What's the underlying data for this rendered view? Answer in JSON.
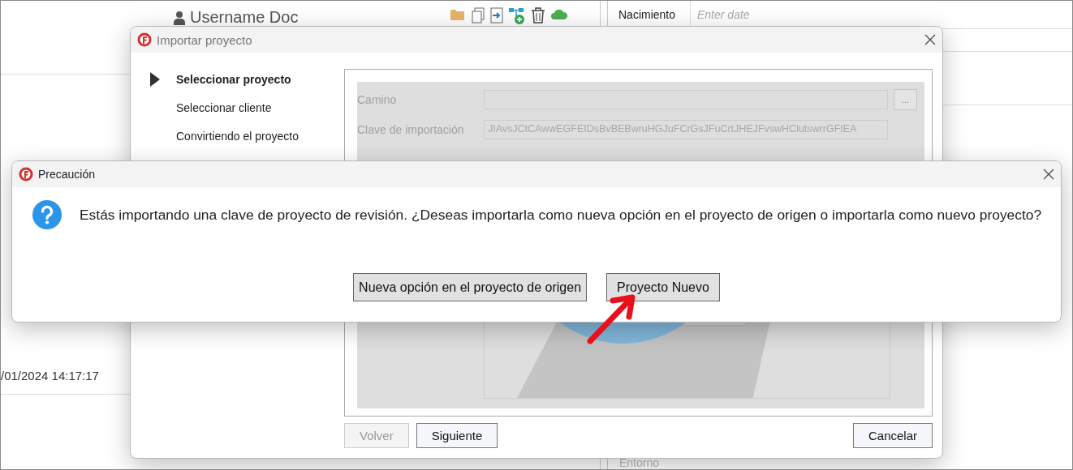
{
  "background_app": {
    "user_name": "Username Doc",
    "birth_field": {
      "label": "Nacimiento",
      "placeholder": "Enter date"
    },
    "timestamp": "/01/2024 14:17:17",
    "environment_label": "Entorno"
  },
  "import_dialog": {
    "title": "Importar proyecto",
    "steps": [
      {
        "label": "Seleccionar proyecto",
        "selected": true
      },
      {
        "label": "Seleccionar cliente",
        "selected": false
      },
      {
        "label": "Convirtiendo el proyecto",
        "selected": false
      }
    ],
    "path": {
      "label": "Camino"
    },
    "browse_button": "...",
    "import_key": {
      "label": "Clave de importación",
      "value": "JIAvsJCtCAwwEGFEIDsBvBEBwruHGJuFCrGsJFuCrtJHEJFvswHClutswrrGFIEA"
    },
    "buttons": [
      {
        "label": "Volver",
        "disabled": true
      },
      {
        "label": "Siguiente",
        "disabled": false
      },
      {
        "label": "Cancelar",
        "disabled": false
      }
    ]
  },
  "caution_dialog": {
    "title": "Precaución",
    "message": "Estás importando una clave de proyecto de revisión. ¿Deseas importarla como nueva opción en el proyecto de origen o importarla como nuevo proyecto?",
    "buttons": [
      {
        "label": "Nueva opción en el proyecto de origen"
      },
      {
        "label": "Proyecto Nuevo"
      }
    ]
  }
}
